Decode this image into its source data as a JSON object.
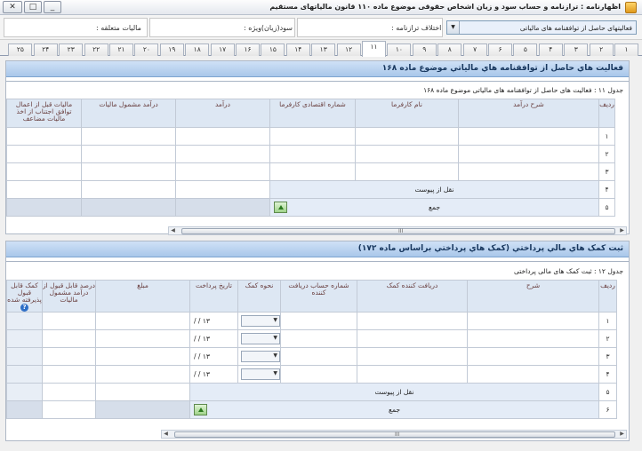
{
  "window": {
    "title": "اظهارنامه : ترازنامه و حساب سود و زیان اشخاص حقوقی موضوع ماده ۱۱۰ قانون مالیاتهای مستقیم"
  },
  "header": {
    "category_value": "فعالیتهای حاصل از توافقنامه های مالیاتی",
    "difference_label": "اختلاف ترازنامه :",
    "special_profit_label": "سود(زیان)ویژه :",
    "tax_due_label": "مالیات متعلقه :"
  },
  "tabs": [
    "۱",
    "۲",
    "۳",
    "۴",
    "۵",
    "۶",
    "۷",
    "۸",
    "۹",
    "۱۰",
    "۱۱",
    "۱۲",
    "۱۳",
    "۱۴",
    "۱۵",
    "۱۶",
    "۱۷",
    "۱۸",
    "۱۹",
    "۲۰",
    "۲۱",
    "۲۲",
    "۲۳",
    "۲۴",
    "۲۵"
  ],
  "active_tab": "۱۱",
  "section1": {
    "title": "فعاليت هاي حاصل از توافقنامه هاي مالياتي موضوع ماده ۱۶۸",
    "caption": "جدول ۱۱ : فعالیت های حاصل از توافقنامه های مالیاتی موضوع ماده ۱۶۸",
    "columns": [
      "ردیف",
      "شرح درآمد",
      "نام کارفرما",
      "شماره اقتصادی کارفرما",
      "درآمد",
      "درآمد مشمول مالیات",
      "مالیات قبل از اعمال توافق اجتناب از اخذ مالیات مضاعف"
    ],
    "rows": [
      "۱",
      "۲",
      "۳"
    ],
    "attach_row": {
      "index": "۴",
      "label": "نقل از پیوست"
    },
    "sum_row": {
      "index": "۵",
      "label": "جمع"
    }
  },
  "section2": {
    "title": "ثبت کمک هاي مالي پرداختي (کمک هاي پرداختي براساس ماده ۱۷۲)",
    "caption": "جدول ۱۲ : ثبت کمک های مالی پرداختی",
    "columns": [
      "ردیف",
      "شرح",
      "دریافت کننده کمک",
      "شماره حساب دریافت کننده",
      "نحوه کمک",
      "تاریخ پرداخت",
      "مبلغ",
      "درصد قابل قبول از درآمد مشمول مالیات",
      "کمک قابل قبول پذیرفته شده"
    ],
    "rows": [
      {
        "index": "۱",
        "date": "۱۳ / /"
      },
      {
        "index": "۲",
        "date": "۱۳ / /"
      },
      {
        "index": "۳",
        "date": "۱۳ / /"
      },
      {
        "index": "۴",
        "date": "۱۳ / /"
      }
    ],
    "attach_row": {
      "index": "۵",
      "label": "نقل از پیوست"
    },
    "sum_row": {
      "index": "۶",
      "label": "جمع"
    }
  },
  "scroll_grip": "III"
}
